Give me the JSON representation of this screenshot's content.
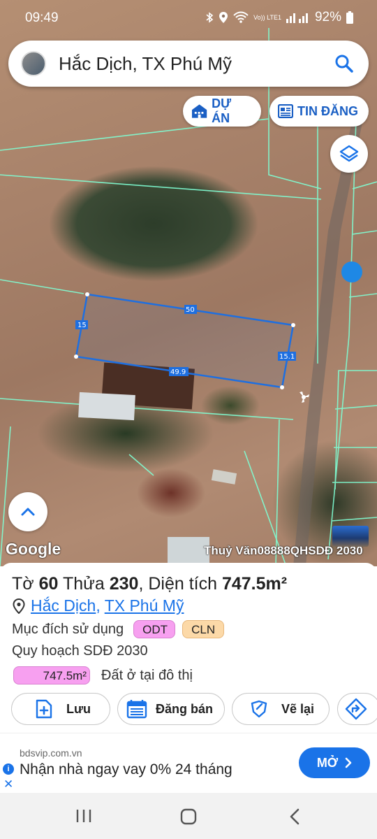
{
  "status_bar": {
    "time": "09:49",
    "network": "Vo)) LTE1",
    "battery": "92%"
  },
  "search": {
    "query": "Hắc Dịch, TX Phú Mỹ"
  },
  "chips": {
    "project": "DỰ ÁN",
    "listing": "TIN ĐĂNG"
  },
  "map": {
    "dimensions": {
      "top": "50",
      "left": "15",
      "bottom": "49.9",
      "right": "15.1"
    },
    "attribution": "Google",
    "watermark": "Thuỷ Văn08888QHSDĐ 2030",
    "parcel_outline_color": "#1e6fe0",
    "boundary_color": "#7fffd4"
  },
  "parcel": {
    "title_prefix": "Tờ",
    "sheet_number": "60",
    "parcel_label": "Thửa",
    "parcel_number": "230",
    "area_label": ", Diện tích",
    "area_value": "747.5m²",
    "address": {
      "commune": "Hắc Dịch",
      "separator": ",",
      "town": "TX Phú Mỹ"
    },
    "purpose_label": "Mục đích sử dụng",
    "purpose_tags": [
      "ODT",
      "CLN"
    ],
    "plan_label": "Quy hoạch SDĐ 2030",
    "plan_area": "747.5m²",
    "plan_description": "Đất ở tại đô thị"
  },
  "actions": {
    "save": "Lưu",
    "post": "Đăng bán",
    "redraw": "Vẽ lại"
  },
  "ad": {
    "domain": "bdsvip.com.vn",
    "headline": "Nhận nhà ngay vay 0% 24 tháng",
    "cta": "MỞ",
    "info_glyph": "i",
    "close_glyph": "✕"
  },
  "colors": {
    "accent_blue": "#1a73e8",
    "odt_tag": "#f7a0f0",
    "cln_tag": "#fcd9a8"
  }
}
